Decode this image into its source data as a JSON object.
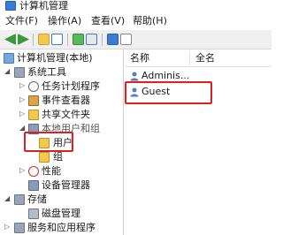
{
  "window": {
    "title": "计算机管理"
  },
  "menu": [
    "文件(F)",
    "操作(A)",
    "查看(V)",
    "帮助(H)"
  ],
  "toolbar": {
    "buttons": [
      "back-icon",
      "forward-icon",
      "up-icon",
      "show-tree-icon",
      "refresh-icon",
      "export-icon",
      "help-icon",
      "properties-icon"
    ]
  },
  "tree": {
    "items": [
      {
        "label": "计算机管理(本地)",
        "expander": "",
        "icon": "computer-icon"
      },
      {
        "label": "系统工具",
        "expander": "◢",
        "icon": "tools-icon"
      },
      {
        "label": "任务计划程序",
        "expander": "▷",
        "icon": "clock-icon"
      },
      {
        "label": "事件查看器",
        "expander": "▷",
        "icon": "event-viewer-icon"
      },
      {
        "label": "共享文件夹",
        "expander": "▷",
        "icon": "shared-folder-icon"
      },
      {
        "label": "本地用户和组",
        "expander": "◢",
        "icon": "users-groups-icon"
      },
      {
        "label": "用户",
        "expander": "",
        "icon": "folder-icon"
      },
      {
        "label": "组",
        "expander": "",
        "icon": "folder-icon"
      },
      {
        "label": "性能",
        "expander": "▷",
        "icon": "performance-icon"
      },
      {
        "label": "设备管理器",
        "expander": "",
        "icon": "device-manager-icon"
      },
      {
        "label": "存储",
        "expander": "◢",
        "icon": "storage-icon"
      },
      {
        "label": "磁盘管理",
        "expander": "",
        "icon": "disk-icon"
      },
      {
        "label": "服务和应用程序",
        "expander": "▷",
        "icon": "services-icon"
      }
    ]
  },
  "list": {
    "columns": [
      "名称",
      "全名"
    ],
    "rows": [
      {
        "name": "Adminis...",
        "fullname": ""
      },
      {
        "name": "Guest",
        "fullname": ""
      }
    ]
  },
  "colors": {
    "highlight": "#e02020",
    "folder": "#f2c94c",
    "accent": "#3a7bd5"
  }
}
